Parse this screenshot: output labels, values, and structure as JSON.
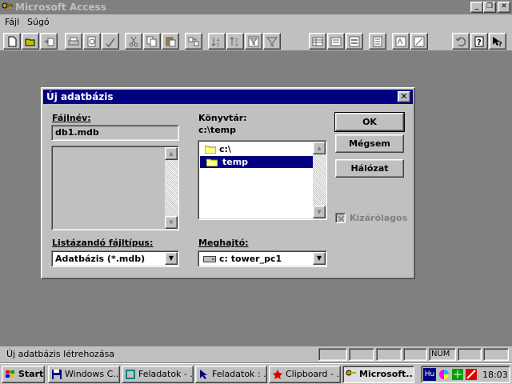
{
  "window": {
    "title": "Microsoft Access",
    "min_icon": "minimize-icon",
    "restore_icon": "restore-icon",
    "close_icon": "close-icon"
  },
  "menu": [
    {
      "label": "Fájl"
    },
    {
      "label": "Súgó"
    }
  ],
  "toolbar": {
    "icons": [
      "new-icon",
      "open-icon",
      "import-icon",
      "print-icon",
      "print-preview-icon",
      "spelling-icon",
      "cut-icon",
      "copy-icon",
      "paste-icon",
      "relationships-icon",
      "sort-asc-icon",
      "sort-desc-icon",
      "filter-icon",
      "apply-filter-icon",
      "table-icon",
      "query-icon",
      "form-icon",
      "report-icon",
      "macro-icon",
      "module-icon",
      "undo-icon",
      "help-icon",
      "context-help-icon"
    ]
  },
  "dialog": {
    "title": "Új adatbázis",
    "filename_label": "Fájlnév:",
    "filename_value": "db1.mdb",
    "directory_label": "Könyvtár:",
    "directory_value": "c:\\temp",
    "dir_items": [
      "c:\\",
      "temp"
    ],
    "filetype_label": "Listázandó fájltípus:",
    "filetype_value": "Adatbázis (*.mdb)",
    "drive_label": "Meghajtó:",
    "drive_value": "c: tower_pc1",
    "ok_label": "OK",
    "cancel_label": "Mégsem",
    "network_label": "Hálózat",
    "exclusive_label": "Kizárólagos",
    "exclusive_checked": true
  },
  "status": {
    "text": "Új adatbázis létrehozása",
    "num": "NUM"
  },
  "taskbar": {
    "start": "Start",
    "tasks": [
      {
        "label": "Windows C...",
        "icon": "floppy-icon"
      },
      {
        "label": "Feladatok - ...",
        "icon": "tasks-icon"
      },
      {
        "label": "Feladatok : ...",
        "icon": "cursor-icon"
      },
      {
        "label": "Clipboard - ...",
        "icon": "clipboard-icon"
      },
      {
        "label": "Microsoft...",
        "icon": "access-key-icon"
      }
    ],
    "lang": "Hu",
    "clock": "18:03"
  }
}
